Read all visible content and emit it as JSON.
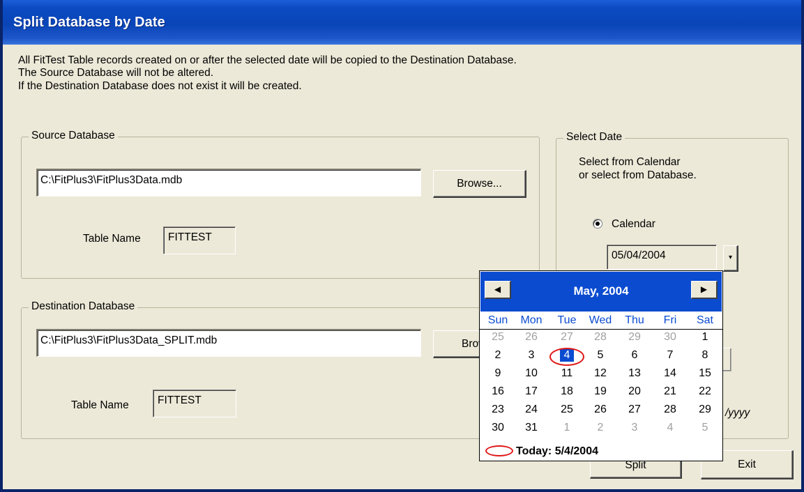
{
  "window": {
    "title": "Split Database by Date"
  },
  "description": [
    "All FitTest Table records created on or after the selected date will be copied to the Destination Database.",
    "The Source Database will not be altered.",
    "If the Destination Database does not exist it will be created."
  ],
  "source": {
    "legend": "Source Database",
    "path": "C:\\FitPlus3\\FitPlus3Data.mdb",
    "browse_label": "Browse...",
    "table_label": "Table Name",
    "table_value": "FITTEST"
  },
  "destination": {
    "legend": "Destination Database",
    "path": "C:\\FitPlus3\\FitPlus3Data_SPLIT.mdb",
    "browse_label": "Brow",
    "table_label": "Table Name",
    "table_value": "FITTEST"
  },
  "select_date": {
    "legend": "Select Date",
    "hint_line1": "Select from Calendar",
    "hint_line2": "or select from Database.",
    "calendar_radio_label": "Calendar",
    "calendar_selected": true,
    "date_value": "05/04/2004",
    "format_hint_partial": "/yyyy"
  },
  "buttons": {
    "split_label": "Split",
    "exit_label": "Exit"
  },
  "calendar": {
    "month_label": "May, 2004",
    "prev_icon": "left-arrow-icon",
    "next_icon": "right-arrow-icon",
    "weekdays": [
      "Sun",
      "Mon",
      "Tue",
      "Wed",
      "Thu",
      "Fri",
      "Sat"
    ],
    "weeks": [
      [
        "25",
        "26",
        "27",
        "28",
        "29",
        "30",
        "1"
      ],
      [
        "2",
        "3",
        "4",
        "5",
        "6",
        "7",
        "8"
      ],
      [
        "9",
        "10",
        "11",
        "12",
        "13",
        "14",
        "15"
      ],
      [
        "16",
        "17",
        "18",
        "19",
        "20",
        "21",
        "22"
      ],
      [
        "23",
        "24",
        "25",
        "26",
        "27",
        "28",
        "29"
      ],
      [
        "30",
        "31",
        "1",
        "2",
        "3",
        "4",
        "5"
      ]
    ],
    "selected_day": "4",
    "today_label": "Today: 5/4/2004",
    "colors": {
      "header": "#0a4bd0",
      "today_circle": "#e01818"
    }
  }
}
